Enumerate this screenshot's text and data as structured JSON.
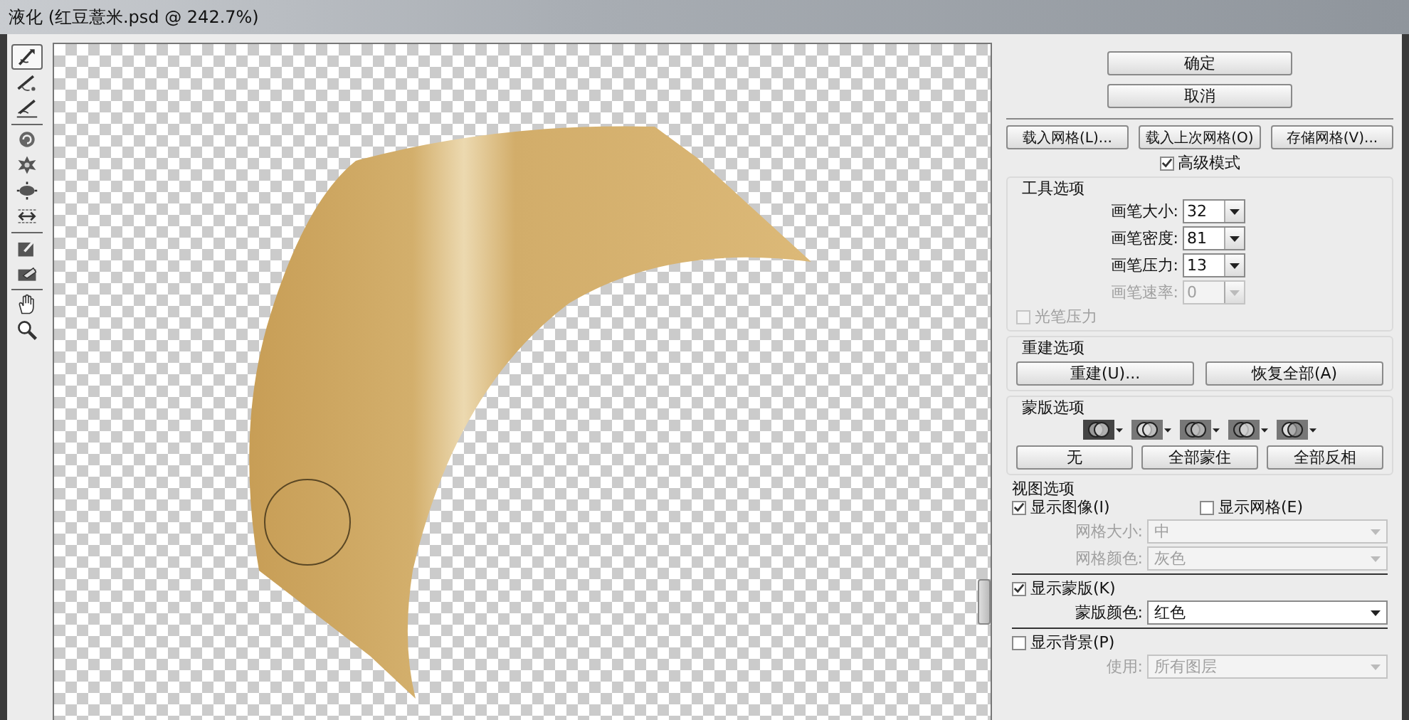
{
  "window": {
    "title": "液化 (红豆薏米.psd @ 242.7%)"
  },
  "tool_groups": [
    [
      {
        "kind": "warp",
        "selected": true
      },
      {
        "kind": "reconstruct",
        "selected": false
      },
      {
        "kind": "smooth",
        "selected": false
      }
    ],
    [
      {
        "kind": "twirl",
        "selected": false
      },
      {
        "kind": "pucker",
        "selected": false
      },
      {
        "kind": "bloat",
        "selected": false
      },
      {
        "kind": "push",
        "selected": false
      }
    ],
    [
      {
        "kind": "freeze",
        "selected": false
      },
      {
        "kind": "thaw",
        "selected": false
      }
    ],
    [
      {
        "kind": "hand",
        "selected": false
      },
      {
        "kind": "zoom",
        "selected": false
      }
    ]
  ],
  "dialog_buttons": [
    "确定",
    "取消"
  ],
  "mesh_buttons": [
    "载入网格(L)...",
    "载入上次网格(O)",
    "存储网格(V)..."
  ],
  "advanced_mode": {
    "label": "高级模式",
    "checked": true
  },
  "tool_options": {
    "title": "工具选项",
    "fields": [
      {
        "label": "画笔大小:",
        "value": "32",
        "disabled": false
      },
      {
        "label": "画笔密度:",
        "value": "81",
        "disabled": false
      },
      {
        "label": "画笔压力:",
        "value": "13",
        "disabled": false
      },
      {
        "label": "画笔速率:",
        "value": "0",
        "disabled": true
      }
    ],
    "stylus": {
      "label": "光笔压力",
      "checked": false,
      "disabled": true
    }
  },
  "reconstruct_options": {
    "title": "重建选项",
    "buttons": [
      "重建(U)...",
      "恢复全部(A)"
    ]
  },
  "mask_options": {
    "title": "蒙版选项",
    "modes": [
      {
        "kind": "replace"
      },
      {
        "kind": "add"
      },
      {
        "kind": "subtract"
      },
      {
        "kind": "intersect"
      },
      {
        "kind": "invert"
      }
    ],
    "buttons": [
      "无",
      "全部蒙住",
      "全部反相"
    ]
  },
  "view_options": {
    "title": "视图选项",
    "show_image": {
      "label": "显示图像(I)",
      "checked": true
    },
    "show_grid": {
      "label": "显示网格(E)",
      "checked": false
    },
    "grid_size": {
      "label": "网格大小:",
      "value": "中",
      "disabled": true
    },
    "grid_color": {
      "label": "网格颜色:",
      "value": "灰色",
      "disabled": true
    },
    "show_mask": {
      "label": "显示蒙版(K)",
      "checked": true
    },
    "mask_color": {
      "label": "蒙版颜色:",
      "value": "红色",
      "disabled": false
    },
    "show_backdrop": {
      "label": "显示背景(P)",
      "checked": false
    },
    "use": {
      "label": "使用:",
      "value": "所有图层",
      "disabled": true
    }
  }
}
